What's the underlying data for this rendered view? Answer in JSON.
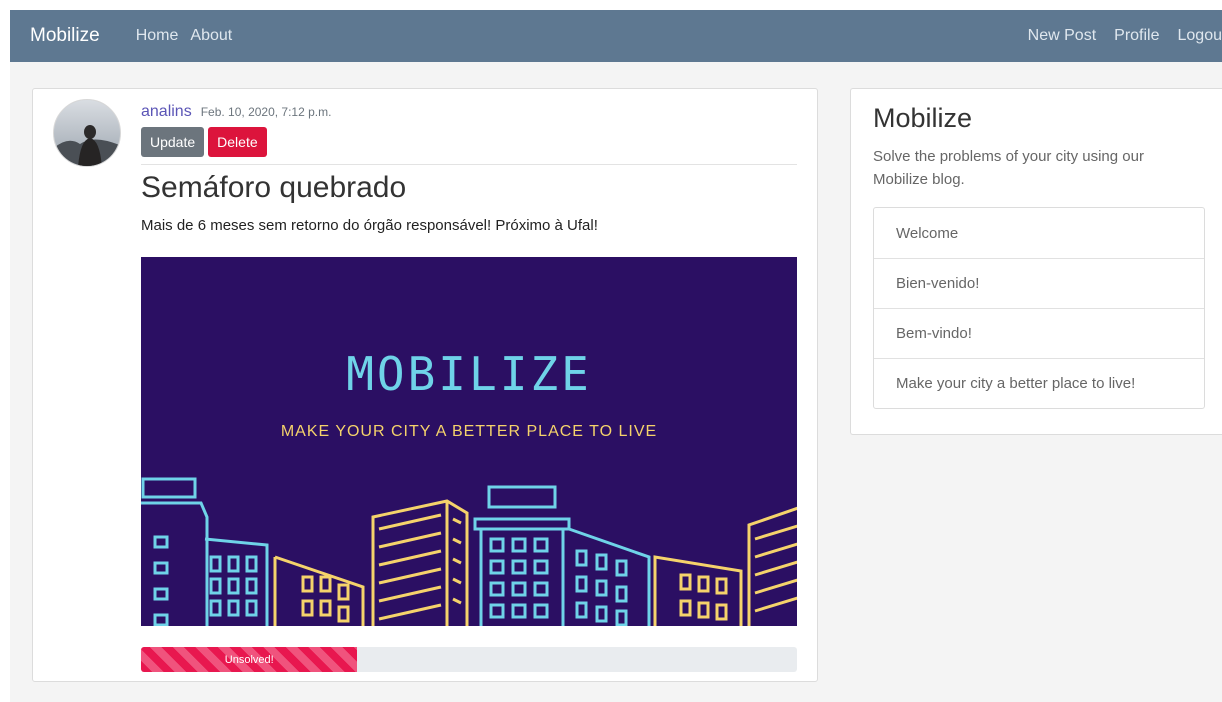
{
  "navbar": {
    "brand": "Mobilize",
    "left_links": [
      "Home",
      "About"
    ],
    "right_links": [
      "New Post",
      "Profile",
      "Logou"
    ],
    "background_color": "#5e7891"
  },
  "post": {
    "author": "analins",
    "date": "Feb. 10, 2020, 7:12 p.m.",
    "update_label": "Update",
    "delete_label": "Delete",
    "title": "Semáforo quebrado",
    "text": "Mais de 6 meses sem retorno do órgão responsável! Próximo à Ufal!",
    "image": {
      "title": "MOBILIZE",
      "subtitle": "MAKE YOUR CITY A BETTER PLACE TO LIVE"
    },
    "status": {
      "label": "Unsolved!",
      "progress_percent": 33,
      "color": "#e8174f"
    }
  },
  "sidebar": {
    "title": "Mobilize",
    "description": "Solve the problems of your city using our Mobilize blog.",
    "items": [
      "Welcome",
      "Bien-venido!",
      "Bem-vindo!",
      "Make your city a better place to live!"
    ]
  }
}
